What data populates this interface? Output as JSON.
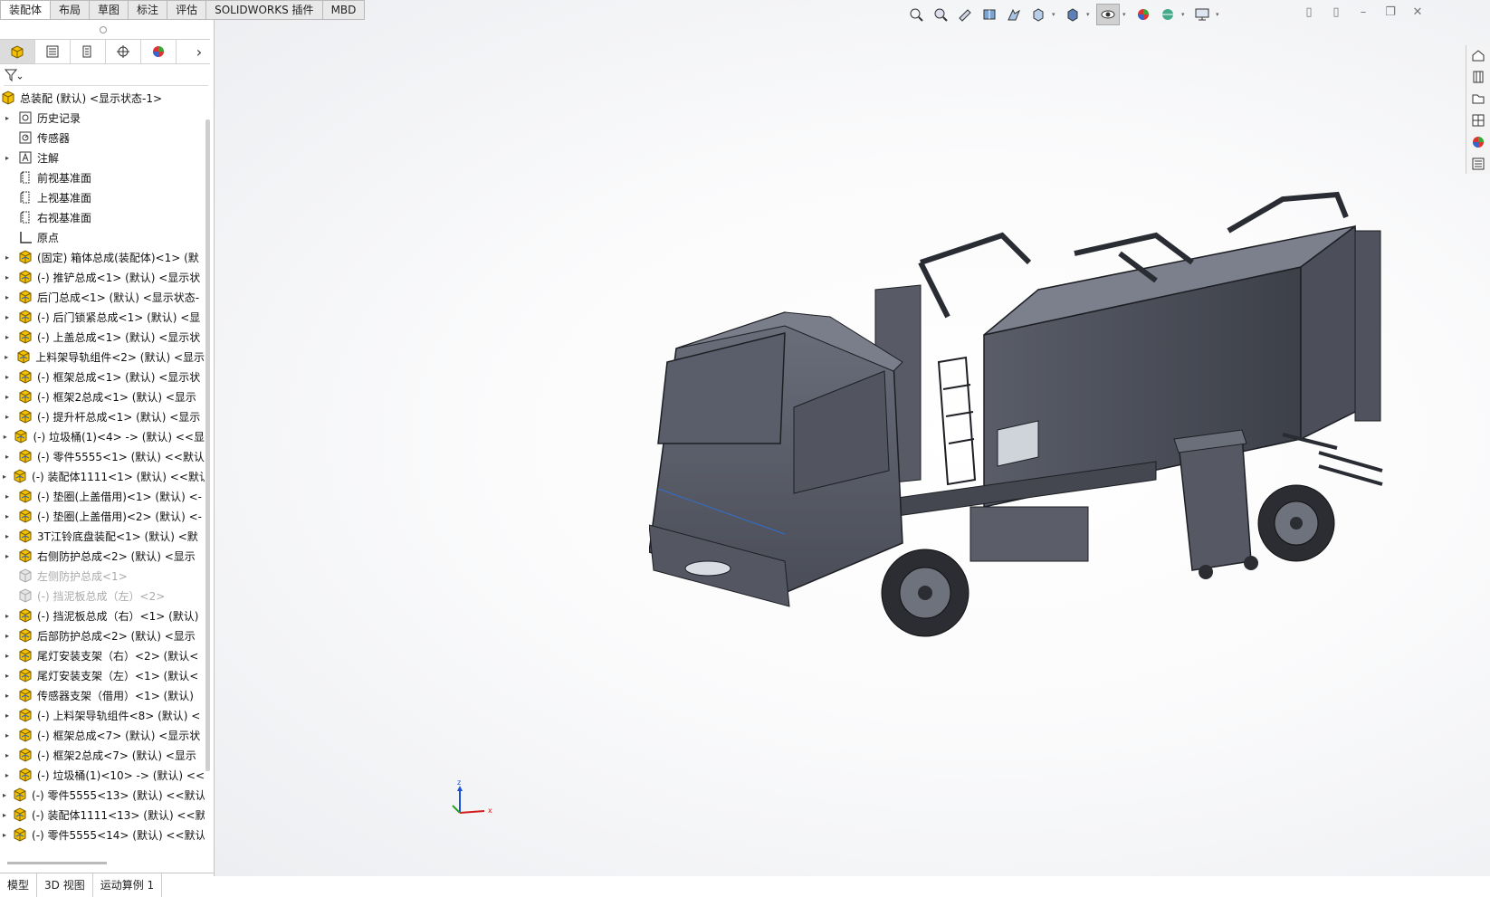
{
  "top_tabs": [
    "装配体",
    "布局",
    "草图",
    "标注",
    "评估",
    "SOLIDWORKS 插件",
    "MBD"
  ],
  "feature_tree": {
    "root": "总装配 (默认) <显示状态-1>",
    "items": [
      {
        "label": "历史记录",
        "icon": "history-icon",
        "expand": true,
        "dim": false
      },
      {
        "label": "传感器",
        "icon": "sensor-icon",
        "expand": false,
        "dim": false
      },
      {
        "label": "注解",
        "icon": "annotation-icon",
        "expand": true,
        "dim": false
      },
      {
        "label": "前视基准面",
        "icon": "plane-icon",
        "expand": false,
        "dim": false
      },
      {
        "label": "上视基准面",
        "icon": "plane-icon",
        "expand": false,
        "dim": false
      },
      {
        "label": "右视基准面",
        "icon": "plane-icon",
        "expand": false,
        "dim": false
      },
      {
        "label": "原点",
        "icon": "origin-icon",
        "expand": false,
        "dim": false
      },
      {
        "label": "(固定) 箱体总成(装配体)<1> (默",
        "icon": "assembly-icon",
        "expand": true,
        "dim": false
      },
      {
        "label": "(-) 推铲总成<1> (默认) <显示状",
        "icon": "assembly-icon",
        "expand": true,
        "dim": false
      },
      {
        "label": "后门总成<1> (默认) <显示状态-",
        "icon": "assembly-icon",
        "expand": true,
        "dim": false
      },
      {
        "label": "(-) 后门锁紧总成<1> (默认) <显",
        "icon": "assembly-icon",
        "expand": true,
        "dim": false
      },
      {
        "label": "(-) 上盖总成<1> (默认) <显示状",
        "icon": "assembly-icon",
        "expand": true,
        "dim": false
      },
      {
        "label": "上料架导轨组件<2> (默认) <显示",
        "icon": "assembly-icon",
        "expand": true,
        "dim": false
      },
      {
        "label": "(-) 框架总成<1> (默认) <显示状",
        "icon": "assembly-icon",
        "expand": true,
        "dim": false
      },
      {
        "label": "(-) 框架2总成<1> (默认) <显示",
        "icon": "assembly-icon",
        "expand": true,
        "dim": false
      },
      {
        "label": "(-) 提升杆总成<1> (默认) <显示",
        "icon": "assembly-icon",
        "expand": true,
        "dim": false
      },
      {
        "label": "(-) 垃圾桶(1)<4> -> (默认) <<显",
        "icon": "assembly-icon",
        "expand": true,
        "dim": false
      },
      {
        "label": "(-) 零件5555<1> (默认) <<默认",
        "icon": "assembly-icon",
        "expand": true,
        "dim": false
      },
      {
        "label": "(-) 装配体1111<1> (默认) <<默认",
        "icon": "assembly-icon",
        "expand": true,
        "dim": false
      },
      {
        "label": "(-) 垫圈(上盖借用)<1> (默认) <-",
        "icon": "assembly-icon",
        "expand": true,
        "dim": false
      },
      {
        "label": "(-) 垫圈(上盖借用)<2> (默认) <-",
        "icon": "assembly-icon",
        "expand": true,
        "dim": false
      },
      {
        "label": "3T江铃底盘装配<1> (默认) <默",
        "icon": "assembly-icon",
        "expand": true,
        "dim": false
      },
      {
        "label": "右侧防护总成<2> (默认) <显示",
        "icon": "assembly-icon",
        "expand": true,
        "dim": false
      },
      {
        "label": "左侧防护总成<1>",
        "icon": "assembly-icon",
        "expand": false,
        "dim": true
      },
      {
        "label": "(-) 挡泥板总成（左）<2>",
        "icon": "assembly-icon",
        "expand": false,
        "dim": true
      },
      {
        "label": "(-) 挡泥板总成（右）<1> (默认)",
        "icon": "assembly-icon",
        "expand": true,
        "dim": false
      },
      {
        "label": "后部防护总成<2> (默认) <显示",
        "icon": "assembly-icon",
        "expand": true,
        "dim": false
      },
      {
        "label": "尾灯安装支架（右）<2> (默认<",
        "icon": "assembly-icon",
        "expand": true,
        "dim": false
      },
      {
        "label": "尾灯安装支架（左）<1> (默认<",
        "icon": "assembly-icon",
        "expand": true,
        "dim": false
      },
      {
        "label": "传感器支架（借用）<1> (默认)",
        "icon": "assembly-icon",
        "expand": true,
        "dim": false
      },
      {
        "label": "(-) 上料架导轨组件<8> (默认) <",
        "icon": "assembly-icon",
        "expand": true,
        "dim": false
      },
      {
        "label": "(-) 框架总成<7> (默认) <显示状",
        "icon": "assembly-icon",
        "expand": true,
        "dim": false
      },
      {
        "label": "(-) 框架2总成<7> (默认) <显示",
        "icon": "assembly-icon",
        "expand": true,
        "dim": false
      },
      {
        "label": "(-) 垃圾桶(1)<10> -> (默认) <<",
        "icon": "assembly-icon",
        "expand": true,
        "dim": false
      },
      {
        "label": "(-) 零件5555<13> (默认) <<默认",
        "icon": "assembly-icon",
        "expand": true,
        "dim": false
      },
      {
        "label": "(-) 装配体1111<13> (默认) <<默",
        "icon": "assembly-icon",
        "expand": true,
        "dim": false
      },
      {
        "label": "(-) 零件5555<14> (默认) <<默认",
        "icon": "assembly-icon",
        "expand": true,
        "dim": false
      }
    ]
  },
  "bottom_tabs": [
    "模型",
    "3D 视图",
    "运动算例 1"
  ],
  "triad": {
    "x": "x",
    "y": "y",
    "z": "z"
  }
}
